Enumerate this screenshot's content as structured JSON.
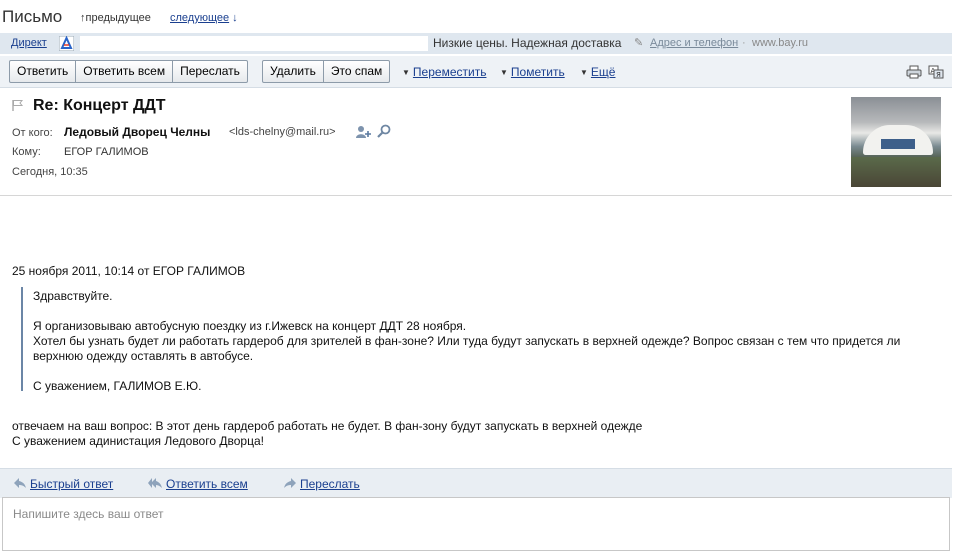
{
  "header": {
    "title": "Письмо",
    "prev_label": "предыдущее",
    "next_label": "следующее"
  },
  "ad": {
    "direct_label": "Директ",
    "text": "Низкие цены. Надежная доставка",
    "address_label": "Адрес и телефон",
    "separator": "·",
    "url": "www.bay.ru"
  },
  "toolbar": {
    "reply": "Ответить",
    "reply_all": "Ответить всем",
    "forward": "Переслать",
    "delete": "Удалить",
    "spam": "Это спам",
    "move": "Переместить",
    "mark": "Пометить",
    "more": "Ещё"
  },
  "message": {
    "subject": "Re: Концерт ДДТ",
    "from_label": "От кого:",
    "from_name": "Ледовый Дворец Челны",
    "from_email": "<lds-chelny@mail.ru>",
    "to_label": "Кому:",
    "to_name": "ЕГОР ГАЛИМОВ",
    "date": "Сегодня, 10:35"
  },
  "body": {
    "quote_header": "25 ноября 2011, 10:14 от ЕГОР ГАЛИМОВ",
    "quote_greeting": "Здравствуйте.",
    "quote_line1": "Я организовываю автобусную поездку из г.Ижевск на концерт ДДТ 28 ноября.",
    "quote_line2": "Хотел бы узнать будет ли работать гардероб для  зрителей в фан-зоне? Или туда будут запускать в верхней одежде? Вопрос связан с тем что придется ли",
    "quote_line3": "верхнюю одежду оставлять в автобусе.",
    "quote_sign": "С уважением, ГАЛИМОВ Е.Ю.",
    "reply_line1": "отвечаем на ваш вопрос: В этот день гардероб работать не будет. В фан-зону будут запускать в верхней одежде",
    "reply_line2": "С уважением адинистация Ледового Дворца!"
  },
  "quick_reply": {
    "fast_reply": "Быстрый ответ",
    "reply_all": "Ответить всем",
    "forward": "Переслать",
    "placeholder": "Напишите здесь ваш ответ"
  }
}
